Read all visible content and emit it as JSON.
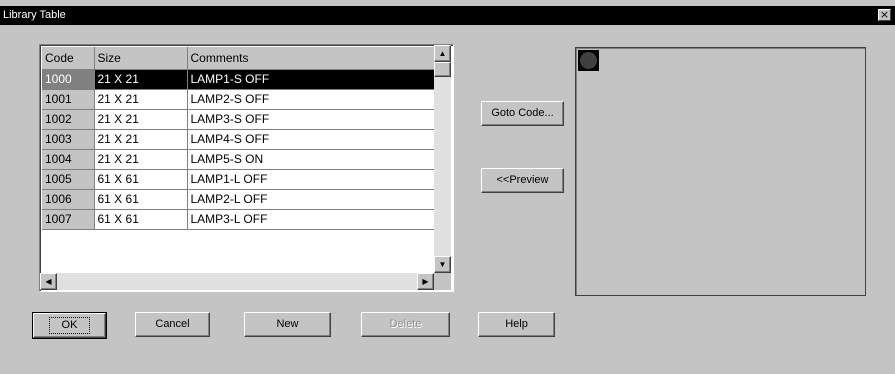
{
  "window": {
    "title": "Library Table",
    "close_glyph": "×"
  },
  "table": {
    "columns": [
      "Code",
      "Size",
      "Comments"
    ],
    "rows": [
      {
        "code": "1000",
        "size": "21 X 21",
        "comment": "LAMP1-S OFF",
        "selected": true
      },
      {
        "code": "1001",
        "size": "21 X 21",
        "comment": "LAMP2-S OFF"
      },
      {
        "code": "1002",
        "size": "21 X 21",
        "comment": "LAMP3-S OFF"
      },
      {
        "code": "1003",
        "size": "21 X 21",
        "comment": "LAMP4-S OFF"
      },
      {
        "code": "1004",
        "size": "21 X 21",
        "comment": "LAMP5-S ON"
      },
      {
        "code": "1005",
        "size": "61 X 61",
        "comment": "LAMP1-L OFF"
      },
      {
        "code": "1006",
        "size": "61 X 61",
        "comment": "LAMP2-L OFF"
      },
      {
        "code": "1007",
        "size": "61 X 61",
        "comment": "LAMP3-L OFF"
      }
    ],
    "scroll_icons": {
      "up": "▲",
      "down": "▼",
      "left": "◀",
      "right": "▶"
    }
  },
  "side_buttons": {
    "goto": "Goto Code...",
    "preview": "<<Preview"
  },
  "buttons": {
    "ok": "OK",
    "cancel": "Cancel",
    "new": "New",
    "delete": "Delete",
    "help": "Help"
  },
  "preview": {
    "icon": "lamp-icon"
  }
}
